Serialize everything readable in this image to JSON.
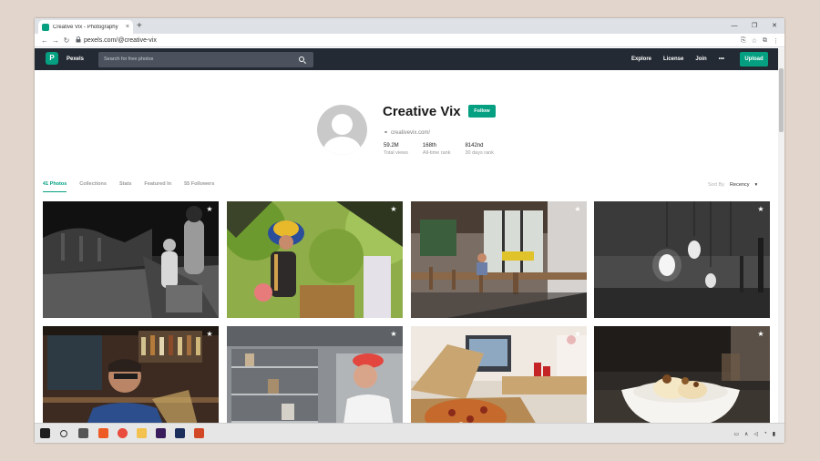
{
  "browser": {
    "tab_title": "Creative Vix - Photography",
    "tab_close": "×",
    "new_tab": "+",
    "url": "pexels.com/@creative-vix",
    "controls": {
      "minimize": "—",
      "maximize": "❐",
      "close": "✕"
    }
  },
  "site": {
    "brand": "Pexels",
    "logo_letter": "P",
    "search_placeholder": "Search for free photos",
    "nav": [
      "Explore",
      "License",
      "Join",
      "•••"
    ],
    "upload": "Upload",
    "accent": "#05a081",
    "nav_bg": "#232a34"
  },
  "profile": {
    "name": "Creative Vix",
    "follow": "Follow",
    "website": "creativevix.com/",
    "stats": [
      {
        "value": "59.2M",
        "label": "Total views"
      },
      {
        "value": "168th",
        "label": "All-time rank"
      },
      {
        "value": "8142nd",
        "label": "30 days rank"
      }
    ]
  },
  "tabs": [
    "41 Photos",
    "Collections",
    "Stats",
    "Featured In",
    "55 Followers"
  ],
  "sort": {
    "label": "Sort By",
    "value": "Recency"
  },
  "photos": [
    "dark-alley-couple",
    "feathered-headdress-vendor",
    "cafe-interior",
    "hanging-lightbulbs",
    "man-at-bar",
    "chef-in-kitchen",
    "pizza-box-laptop",
    "dessert-bowl"
  ],
  "icons": {
    "star": "★",
    "back": "←",
    "forward": "→",
    "reload": "↻",
    "lock": "🔒",
    "link": "⚭",
    "chevron": "▾"
  }
}
